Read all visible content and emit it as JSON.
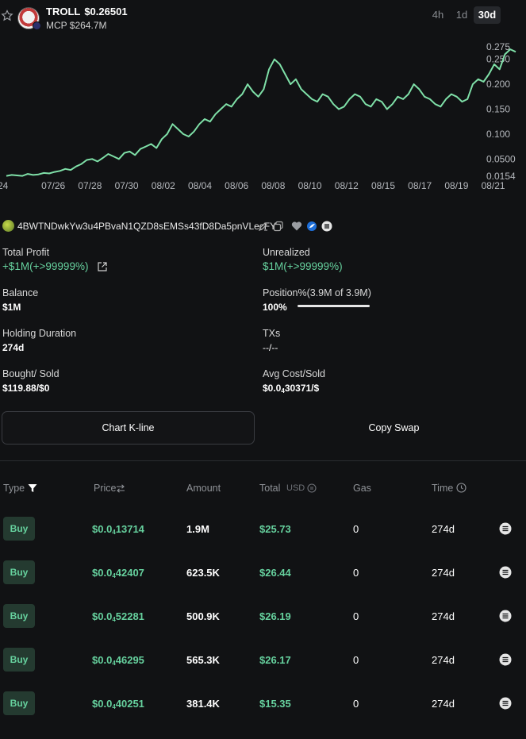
{
  "token": {
    "symbol": "TROLL",
    "price": "$0.26501",
    "mcp": "MCP $264.7M"
  },
  "timeframes": [
    {
      "label": "4h",
      "active": false
    },
    {
      "label": "1d",
      "active": false
    },
    {
      "label": "30d",
      "active": true
    }
  ],
  "chart_data": {
    "type": "line",
    "x_tick_labels": [
      "24",
      "07/26",
      "07/28",
      "07/30",
      "08/02",
      "08/04",
      "08/06",
      "08/08",
      "08/10",
      "08/12",
      "08/15",
      "08/17",
      "08/19",
      "08/21"
    ],
    "y_tick_labels": [
      "0.275",
      "0.250",
      "0.200",
      "0.150",
      "0.100",
      "0.0500",
      "0.0154"
    ],
    "ylim": [
      0.0154,
      0.275
    ],
    "series": [
      {
        "color": "#7fe0a8",
        "values": [
          0.016,
          0.018,
          0.017,
          0.016,
          0.02,
          0.018,
          0.019,
          0.022,
          0.021,
          0.024,
          0.026,
          0.03,
          0.028,
          0.035,
          0.04,
          0.048,
          0.05,
          0.045,
          0.052,
          0.06,
          0.055,
          0.05,
          0.062,
          0.065,
          0.058,
          0.07,
          0.075,
          0.08,
          0.072,
          0.09,
          0.1,
          0.12,
          0.11,
          0.1,
          0.095,
          0.105,
          0.12,
          0.13,
          0.125,
          0.14,
          0.15,
          0.16,
          0.155,
          0.17,
          0.18,
          0.2,
          0.185,
          0.175,
          0.19,
          0.23,
          0.25,
          0.24,
          0.22,
          0.2,
          0.21,
          0.19,
          0.18,
          0.17,
          0.165,
          0.18,
          0.175,
          0.16,
          0.15,
          0.155,
          0.17,
          0.18,
          0.175,
          0.16,
          0.155,
          0.17,
          0.165,
          0.15,
          0.16,
          0.175,
          0.17,
          0.18,
          0.2,
          0.19,
          0.175,
          0.17,
          0.16,
          0.155,
          0.17,
          0.18,
          0.175,
          0.165,
          0.17,
          0.2,
          0.21,
          0.205,
          0.22,
          0.24,
          0.23,
          0.26,
          0.27,
          0.265
        ]
      }
    ],
    "grid": false,
    "legend": "none"
  },
  "wallet": {
    "address": "4BWTNDwkYw3u4PBvaN1QZD8sEMSs43fD8Da5pnVLecFY"
  },
  "stats": {
    "total_profit_label": "Total Profit",
    "total_profit_value": "+$1M(+>99999%)",
    "unrealized_label": "Unrealized",
    "unrealized_value": "$1M(+>99999%)",
    "balance_label": "Balance",
    "balance_value": "$1M",
    "position_label": "Position%(3.9M of 3.9M)",
    "position_value": "100%",
    "position_fraction": 1.0,
    "holding_label": "Holding Duration",
    "holding_value": "274d",
    "txs_label": "TXs",
    "txs_value": "--/--",
    "bought_label": "Bought/ Sold",
    "bought_value": "$119.88/$0",
    "avgcost_label": "Avg Cost/Sold",
    "avgcost_prefix": "$0.0",
    "avgcost_sub": "4",
    "avgcost_rest": "30371/$"
  },
  "buttons": {
    "chart_kline": "Chart K-line",
    "copy_swap": "Copy Swap"
  },
  "table": {
    "headers": {
      "type": "Type",
      "price": "Price",
      "amount": "Amount",
      "total": "Total",
      "total_unit": "USD",
      "gas": "Gas",
      "time": "Time"
    },
    "rows": [
      {
        "type": "Buy",
        "price_prefix": "$0.0",
        "price_sub": "4",
        "price_rest": "13714",
        "amount": "1.9M",
        "total": "$25.73",
        "gas": "0",
        "time": "274d"
      },
      {
        "type": "Buy",
        "price_prefix": "$0.0",
        "price_sub": "4",
        "price_rest": "42407",
        "amount": "623.5K",
        "total": "$26.44",
        "gas": "0",
        "time": "274d"
      },
      {
        "type": "Buy",
        "price_prefix": "$0.0",
        "price_sub": "4",
        "price_rest": "52281",
        "amount": "500.9K",
        "total": "$26.19",
        "gas": "0",
        "time": "274d"
      },
      {
        "type": "Buy",
        "price_prefix": "$0.0",
        "price_sub": "4",
        "price_rest": "46295",
        "amount": "565.3K",
        "total": "$26.17",
        "gas": "0",
        "time": "274d"
      },
      {
        "type": "Buy",
        "price_prefix": "$0.0",
        "price_sub": "4",
        "price_rest": "40251",
        "amount": "381.4K",
        "total": "$15.35",
        "gas": "0",
        "time": "274d"
      }
    ]
  }
}
